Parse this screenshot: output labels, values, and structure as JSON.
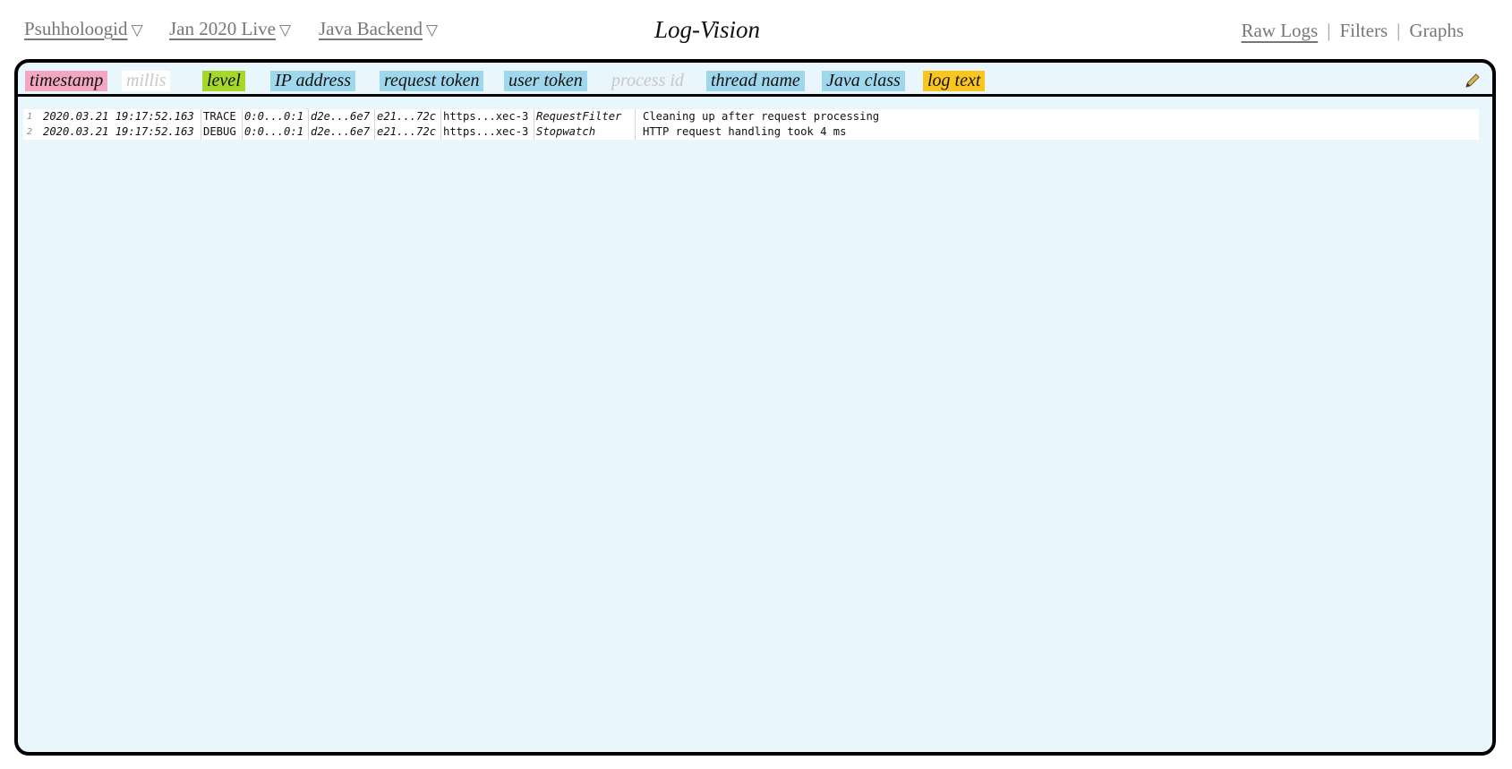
{
  "header": {
    "dropdowns": [
      {
        "label": "Psuhholoogid",
        "arrow": "▽"
      },
      {
        "label": "Jan 2020 Live",
        "arrow": "▽"
      },
      {
        "label": "Java Backend",
        "arrow": "▽"
      }
    ],
    "title": "Log-Vision",
    "nav": [
      {
        "label": "Raw Logs",
        "active": true
      },
      {
        "label": "Filters",
        "active": false
      },
      {
        "label": "Graphs",
        "active": false
      }
    ],
    "nav_separator": "|"
  },
  "fields": [
    {
      "label": "timestamp",
      "color": "#f4a7c3",
      "enabled": true
    },
    {
      "label": "millis",
      "color": "#ffffff",
      "enabled": false
    },
    {
      "label": "level",
      "color": "#a6d82a",
      "enabled": true
    },
    {
      "label": "IP address",
      "color": "#9fd8ec",
      "enabled": true
    },
    {
      "label": "request token",
      "color": "#9fd8ec",
      "enabled": true
    },
    {
      "label": "user token",
      "color": "#9fd8ec",
      "enabled": true
    },
    {
      "label": "process id",
      "color": "#e9f6fb",
      "enabled": false
    },
    {
      "label": "thread name",
      "color": "#9fd8ec",
      "enabled": true
    },
    {
      "label": "Java class",
      "color": "#9fd8ec",
      "enabled": true
    },
    {
      "label": "log text",
      "color": "#f9c51f",
      "enabled": true
    }
  ],
  "edit_icon": "pencil-icon",
  "log_lines": [
    {
      "num": "1",
      "timestamp": "2020.03.21 19:17:52.163",
      "level": "TRACE",
      "ip": "0:0...0:1",
      "request_token": "d2e...6e7",
      "user_token": "e21...72c",
      "thread": "https...xec-3",
      "java_class": "RequestFilter",
      "text": "Cleaning up after request processing"
    },
    {
      "num": "2",
      "timestamp": "2020.03.21 19:17:52.163",
      "level": "DEBUG",
      "ip": "0:0...0:1",
      "request_token": "d2e...6e7",
      "user_token": "e21...72c",
      "thread": "https...xec-3",
      "java_class": "Stopwatch",
      "text": "HTTP request handling took 4 ms"
    }
  ]
}
